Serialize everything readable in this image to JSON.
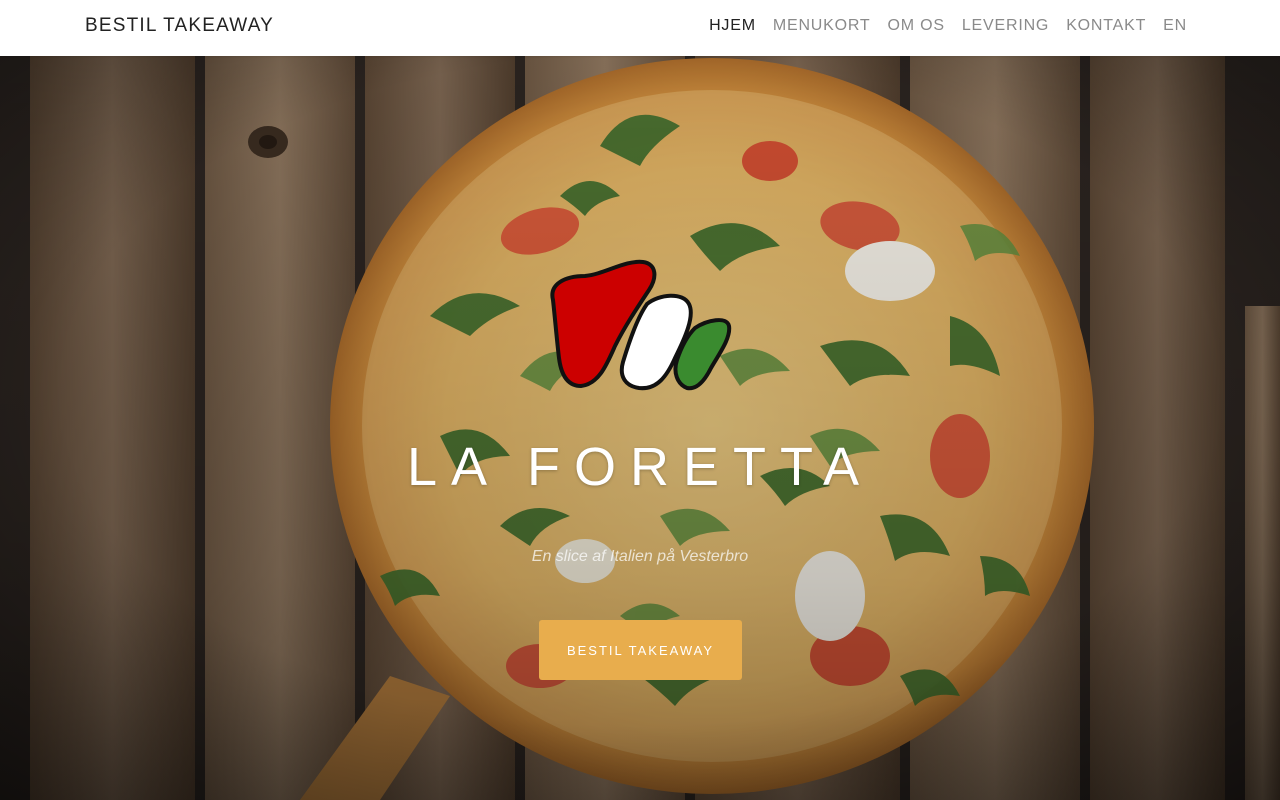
{
  "navbar": {
    "brand": "BESTIL TAKEAWAY",
    "items": [
      {
        "label": "HJEM",
        "active": true
      },
      {
        "label": "MENUKORT",
        "active": false
      },
      {
        "label": "OM OS",
        "active": false
      },
      {
        "label": "LEVERING",
        "active": false
      },
      {
        "label": "KONTAKT",
        "active": false
      },
      {
        "label": "EN",
        "active": false
      }
    ]
  },
  "hero": {
    "title": "LA FORETTA",
    "subtitle": "En slice af Italien på Vesterbro",
    "cta_label": "BESTIL TAKEAWAY",
    "logo_icon": "italian-flag-leaf-logo"
  },
  "colors": {
    "accent": "#e8ad4d",
    "logo_red": "#cc0000",
    "logo_white": "#ffffff",
    "logo_green": "#3a8b2f"
  }
}
